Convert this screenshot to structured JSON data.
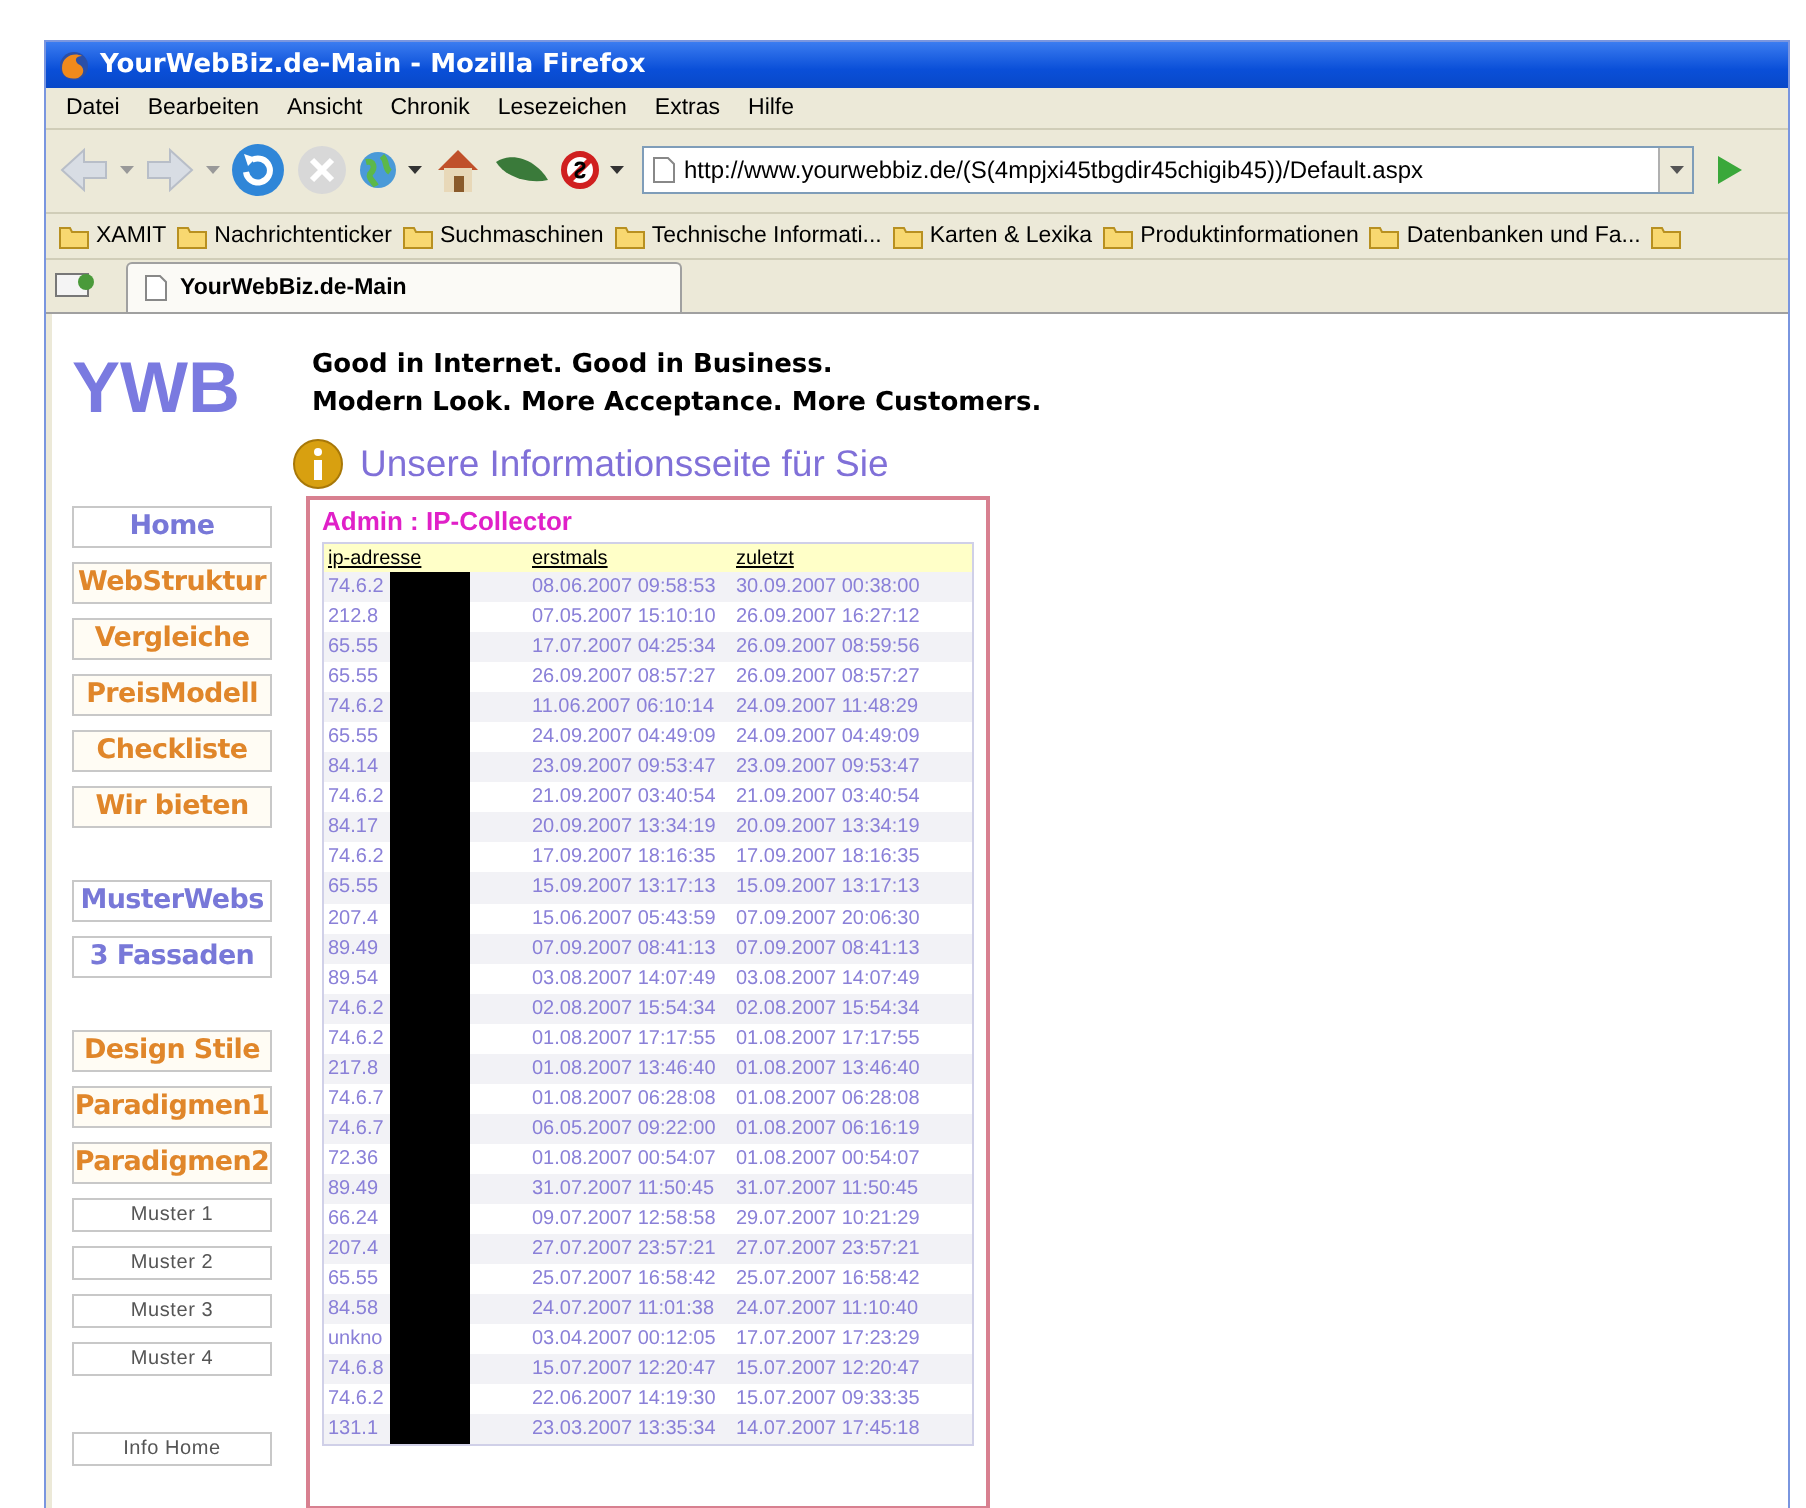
{
  "window": {
    "title": "YourWebBiz.de-Main - Mozilla Firefox"
  },
  "menu": [
    "Datei",
    "Bearbeiten",
    "Ansicht",
    "Chronik",
    "Lesezeichen",
    "Extras",
    "Hilfe"
  ],
  "address": {
    "value": "http://www.yourwebbiz.de/(S(4mpjxi45tbgdir45chigib45))/Default.aspx"
  },
  "bookmarks": [
    "XAMIT",
    "Nachrichtenticker",
    "Suchmaschinen",
    "Technische Informati...",
    "Karten & Lexika",
    "Produktinformationen",
    "Datenbanken und Fa..."
  ],
  "tabs": [
    {
      "label": "YourWebBiz.de-Main",
      "selected": true
    }
  ],
  "page": {
    "logo": "YWB",
    "taglines": [
      "Good in Internet. Good in Business.",
      "Modern Look. More Acceptance. More Customers."
    ],
    "heading": "Unsere Informationsseite für Sie",
    "sidebar": {
      "groups": [
        [
          {
            "label": "Home",
            "kind": "blue"
          },
          {
            "label": "WebStruktur",
            "kind": "orange"
          },
          {
            "label": "Vergleiche",
            "kind": "orange"
          },
          {
            "label": "PreisModell",
            "kind": "orange"
          },
          {
            "label": "Checkliste",
            "kind": "orange"
          },
          {
            "label": "Wir bieten",
            "kind": "orange"
          }
        ],
        [
          {
            "label": "MusterWebs",
            "kind": "blue"
          },
          {
            "label": "3 Fassaden",
            "kind": "blue"
          }
        ],
        [
          {
            "label": "Design Stile",
            "kind": "orange"
          },
          {
            "label": "Paradigmen1",
            "kind": "orange"
          },
          {
            "label": "Paradigmen2",
            "kind": "orange"
          },
          {
            "label": "Muster 1",
            "kind": "small"
          },
          {
            "label": "Muster 2",
            "kind": "small"
          },
          {
            "label": "Muster 3",
            "kind": "small"
          },
          {
            "label": "Muster 4",
            "kind": "small"
          }
        ],
        [
          {
            "label": "Info Home",
            "kind": "small"
          }
        ]
      ]
    },
    "panel": {
      "title": "Admin : IP-Collector",
      "table": {
        "columns": [
          "ip-adresse",
          "erstmals",
          "zuletzt"
        ],
        "rows": [
          [
            "74.6.2",
            "08.06.2007 09:58:53",
            "30.09.2007 00:38:00"
          ],
          [
            "212.8",
            "07.05.2007 15:10:10",
            "26.09.2007 16:27:12"
          ],
          [
            "65.55",
            "17.07.2007 04:25:34",
            "26.09.2007 08:59:56"
          ],
          [
            "65.55",
            "26.09.2007 08:57:27",
            "26.09.2007 08:57:27"
          ],
          [
            "74.6.2",
            "11.06.2007 06:10:14",
            "24.09.2007 11:48:29"
          ],
          [
            "65.55",
            "24.09.2007 04:49:09",
            "24.09.2007 04:49:09"
          ],
          [
            "84.14",
            "23.09.2007 09:53:47",
            "23.09.2007 09:53:47"
          ],
          [
            "74.6.2",
            "21.09.2007 03:40:54",
            "21.09.2007 03:40:54"
          ],
          [
            "84.17",
            "20.09.2007 13:34:19",
            "20.09.2007 13:34:19"
          ],
          [
            "74.6.2",
            "17.09.2007 18:16:35",
            "17.09.2007 18:16:35"
          ],
          [
            "65.55",
            "15.09.2007 13:17:13",
            "15.09.2007 13:17:13"
          ],
          [
            "207.4",
            "15.06.2007 05:43:59",
            "07.09.2007 20:06:30"
          ],
          [
            "89.49",
            "07.09.2007 08:41:13",
            "07.09.2007 08:41:13"
          ],
          [
            "89.54",
            "03.08.2007 14:07:49",
            "03.08.2007 14:07:49"
          ],
          [
            "74.6.2",
            "02.08.2007 15:54:34",
            "02.08.2007 15:54:34"
          ],
          [
            "74.6.2",
            "01.08.2007 17:17:55",
            "01.08.2007 17:17:55"
          ],
          [
            "217.8",
            "01.08.2007 13:46:40",
            "01.08.2007 13:46:40"
          ],
          [
            "74.6.7",
            "01.08.2007 06:28:08",
            "01.08.2007 06:28:08"
          ],
          [
            "74.6.7",
            "06.05.2007 09:22:00",
            "01.08.2007 06:16:19"
          ],
          [
            "72.36",
            "01.08.2007 00:54:07",
            "01.08.2007 00:54:07"
          ],
          [
            "89.49",
            "31.07.2007 11:50:45",
            "31.07.2007 11:50:45"
          ],
          [
            "66.24",
            "09.07.2007 12:58:58",
            "29.07.2007 10:21:29"
          ],
          [
            "207.4",
            "27.07.2007 23:57:21",
            "27.07.2007 23:57:21"
          ],
          [
            "65.55",
            "25.07.2007 16:58:42",
            "25.07.2007 16:58:42"
          ],
          [
            "84.58",
            "24.07.2007 11:01:38",
            "24.07.2007 11:10:40"
          ],
          [
            "unkno",
            "03.04.2007 00:12:05",
            "17.07.2007 17:23:29"
          ],
          [
            "74.6.8",
            "15.07.2007 12:20:47",
            "15.07.2007 12:20:47"
          ],
          [
            "74.6.2",
            "22.06.2007 14:19:30",
            "15.07.2007 09:33:35"
          ],
          [
            "131.1",
            "23.03.2007 13:35:34",
            "14.07.2007 17:45:18"
          ]
        ]
      }
    }
  }
}
